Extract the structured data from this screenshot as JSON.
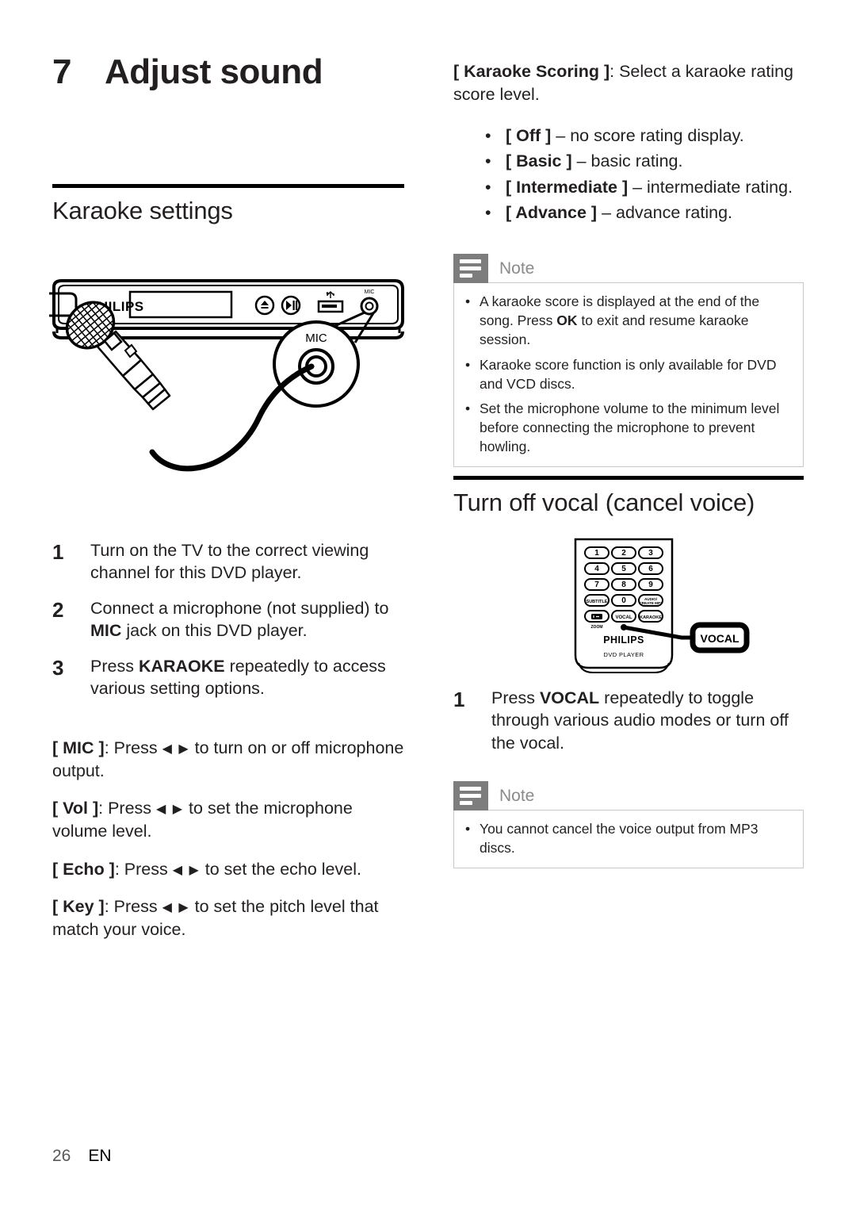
{
  "chapter": {
    "number": "7",
    "title": "Adjust sound"
  },
  "sections": {
    "karaoke_settings": {
      "heading": "Karaoke settings",
      "steps": [
        {
          "num": "1",
          "pre": "Turn on the TV to the correct viewing channel for this DVD player."
        },
        {
          "num": "2",
          "pre": "Connect a microphone (not supplied) to ",
          "bold": "MIC",
          "post": " jack on this DVD player."
        },
        {
          "num": "3",
          "pre": "Press ",
          "bold": "KARAOKE",
          "post": " repeatedly to access various setting options."
        }
      ],
      "options": [
        {
          "key": "[ MIC ]",
          "sep": ": Press ",
          "arrows": "◀ ▶",
          "rest": " to turn on or off microphone output."
        },
        {
          "key": "[ Vol ]",
          "sep": ": Press ",
          "arrows": "◀ ▶",
          "rest": " to set the microphone volume level."
        },
        {
          "key": "[ Echo ]",
          "sep": ": Press ",
          "arrows": "◀ ▶",
          "rest": " to set the echo level."
        },
        {
          "key": "[ Key ]",
          "sep": ": Press ",
          "arrows": "◀ ▶",
          "rest": " to set the pitch level that match your voice."
        }
      ]
    },
    "karaoke_scoring": {
      "key": "[ Karaoke Scoring ]",
      "desc": ": Select a karaoke rating score level.",
      "items": [
        {
          "bullet": "•",
          "key": "[ Off ]",
          "rest": " – no score rating display."
        },
        {
          "bullet": "•",
          "key": "[ Basic ]",
          "rest": " – basic rating."
        },
        {
          "bullet": "•",
          "key": "[ Intermediate ]",
          "rest": " – intermediate rating."
        },
        {
          "bullet": "•",
          "key": "[ Advance ]",
          "rest": " – advance rating."
        }
      ]
    },
    "note_scoring": {
      "label": "Note",
      "items": [
        {
          "bullet": "•",
          "pre": "A karaoke score is displayed at the end of the song. Press ",
          "bold": "OK",
          "post": " to exit and resume karaoke session."
        },
        {
          "bullet": "•",
          "pre": "Karaoke score function is only available for DVD and VCD discs.",
          "bold": "",
          "post": ""
        },
        {
          "bullet": "•",
          "pre": "Set the microphone volume to the minimum level before connecting the microphone to prevent howling.",
          "bold": "",
          "post": ""
        }
      ]
    },
    "turn_off_vocal": {
      "heading": "Turn off vocal (cancel voice)",
      "steps": [
        {
          "num": "1",
          "pre": "Press ",
          "bold": "VOCAL",
          "post": " repeatedly to toggle through various audio modes or turn off the vocal."
        }
      ]
    },
    "note_vocal": {
      "label": "Note",
      "items": [
        {
          "bullet": "•",
          "pre": "You cannot cancel the voice output from MP3 discs.",
          "bold": "",
          "post": ""
        }
      ]
    }
  },
  "illustrations": {
    "device": {
      "brand": "PHILIPS",
      "mic_callout_label": "MIC",
      "front_mic_label": "MIC",
      "icons": [
        "eject-icon",
        "play-pause-icon",
        "usb-icon",
        "mic-jack-icon"
      ]
    },
    "remote": {
      "brand": "PHILIPS",
      "model_label": "DVD PLAYER",
      "callout_label": "VOCAL",
      "keys": [
        [
          "1",
          "2",
          "3"
        ],
        [
          "4",
          "5",
          "6"
        ],
        [
          "7",
          "8",
          "9"
        ],
        [
          "SUBTITLE",
          "0",
          "AUDIO/CREATE MP3"
        ],
        [
          "ZOOM",
          "VOCAL",
          "KARAOKE"
        ]
      ],
      "zoom_label": "ZOOM"
    }
  },
  "footer": {
    "page": "26",
    "lang": "EN"
  },
  "colors": {
    "text": "#231f20",
    "note_icon_bg": "#7d7d7d",
    "note_label": "#8a8a8a",
    "note_border": "#c9c9c9"
  }
}
